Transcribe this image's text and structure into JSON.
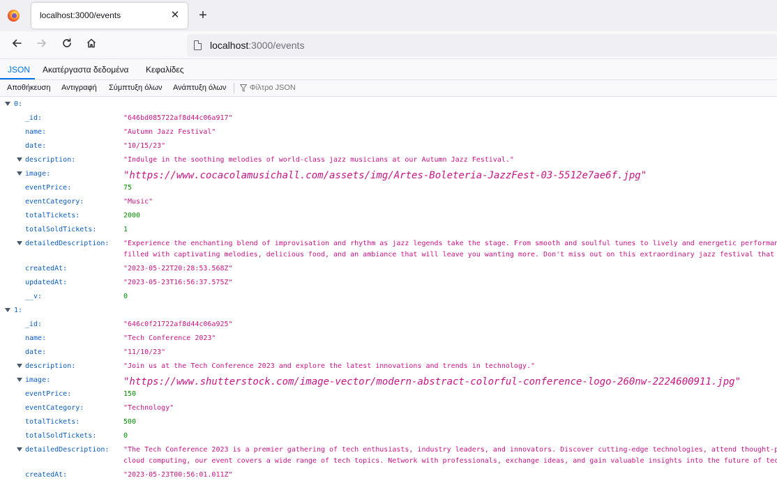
{
  "browser": {
    "tab_title": "localhost:3000/events",
    "close_glyph": "✕",
    "new_tab_glyph": "+",
    "url_host": "localhost",
    "url_rest": ":3000/events"
  },
  "viewer_tabs": {
    "json": "JSON",
    "raw": "Ακατέργαστα δεδομένα",
    "headers": "Κεφαλίδες"
  },
  "toolbar": {
    "save": "Αποθήκευση",
    "copy": "Αντιγραφή",
    "collapse_all": "Σύμπτυξη όλων",
    "expand_all": "Ανάπτυξη όλων",
    "filter_placeholder": "Φίλτρο JSON"
  },
  "events": [
    {
      "index": "0:",
      "_id": "\"646bd085722af8d44c06a917\"",
      "name": "\"Autumn Jazz Festival\"",
      "date": "\"10/15/23\"",
      "description": "\"Indulge in the soothing melodies of world-class jazz musicians at our Autumn Jazz Festival.\"",
      "image": "\"https://www.cocacolamusichall.com/assets/img/Artes-Boleteria-JazzFest-03-5512e7ae6f.jpg\"",
      "eventPrice": "75",
      "eventCategory": "\"Music\"",
      "totalTickets": "2000",
      "totalSoldTickets": "1",
      "detailedDescription_line1": "\"Experience the enchanting blend of improvisation and rhythm as jazz legends take the stage. From smooth and soulful tunes to lively and energetic performan",
      "detailedDescription_line2": "filled with captivating melodies, delicious food, and an ambiance that will leave you wanting more. Don't miss out on this extraordinary jazz festival that p",
      "createdAt": "\"2023-05-22T20:28:53.568Z\"",
      "updatedAt": "\"2023-05-23T16:56:37.575Z\"",
      "__v": "0"
    },
    {
      "index": "1:",
      "_id": "\"646c0f21722af8d44c06a925\"",
      "name": "\"Tech Conference 2023\"",
      "date": "\"11/10/23\"",
      "description": "\"Join us at the Tech Conference 2023 and explore the latest innovations and trends in technology.\"",
      "image": "\"https://www.shutterstock.com/image-vector/modern-abstract-colorful-conference-logo-260nw-2224600911.jpg\"",
      "eventPrice": "150",
      "eventCategory": "\"Technology\"",
      "totalTickets": "500",
      "totalSoldTickets": "0",
      "detailedDescription_line1": "\"The Tech Conference 2023 is a premier gathering of tech enthusiasts, industry leaders, and innovators. Discover cutting-edge technologies, attend thought-p",
      "detailedDescription_line2": "cloud computing, our event covers a wide range of tech topics. Network with professionals, exchange ideas, and gain valuable insights into the future of tec",
      "createdAt": "\"2023-05-23T00:56:01.011Z\""
    }
  ],
  "keys": {
    "_id": "_id:",
    "name": "name:",
    "date": "date:",
    "description": "description:",
    "image": "image:",
    "eventPrice": "eventPrice:",
    "eventCategory": "eventCategory:",
    "totalTickets": "totalTickets:",
    "totalSoldTickets": "totalSoldTickets:",
    "detailedDescription": "detailedDescription:",
    "createdAt": "createdAt:",
    "updatedAt": "updatedAt:",
    "__v": "__v:"
  },
  "colors": {
    "key": "#0b5cbd",
    "string": "#c71585",
    "number": "#058b00",
    "accent": "#0074e8"
  }
}
